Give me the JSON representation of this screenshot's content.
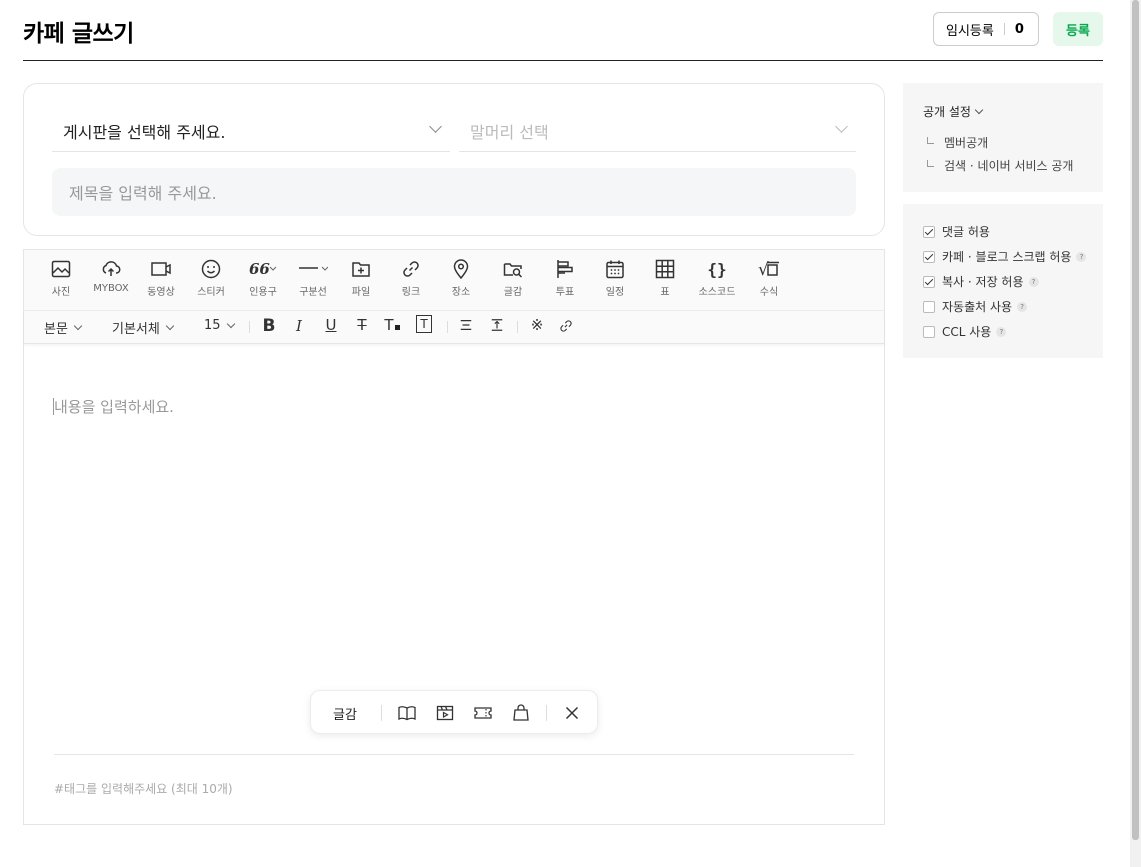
{
  "header": {
    "title": "카페 글쓰기",
    "temp_save_label": "임시등록",
    "temp_save_count": "0",
    "submit_label": "등록"
  },
  "form": {
    "board_select": "게시판을 선택해 주세요.",
    "prefix_select": "말머리 선택",
    "title_placeholder": "제목을 입력해 주세요."
  },
  "toolbar": {
    "items": [
      {
        "label": "사진",
        "icon": "photo-icon"
      },
      {
        "label": "MYBOX",
        "icon": "cloud-upload-icon"
      },
      {
        "label": "동영상",
        "icon": "video-icon"
      },
      {
        "label": "스티커",
        "icon": "sticker-icon"
      },
      {
        "label": "인용구",
        "icon": "quote-icon"
      },
      {
        "label": "구분선",
        "icon": "divider-icon"
      },
      {
        "label": "파일",
        "icon": "file-icon"
      },
      {
        "label": "링크",
        "icon": "link-icon"
      },
      {
        "label": "장소",
        "icon": "place-icon"
      },
      {
        "label": "글감",
        "icon": "material-icon"
      },
      {
        "label": "투표",
        "icon": "vote-icon"
      },
      {
        "label": "일정",
        "icon": "calendar-icon"
      },
      {
        "label": "표",
        "icon": "table-icon"
      },
      {
        "label": "소스코드",
        "icon": "source-code-icon"
      },
      {
        "label": "수식",
        "icon": "formula-icon"
      }
    ],
    "quote_glyph": "66",
    "code_glyph": "{}",
    "formula_glyph": "√",
    "formula_box": "□"
  },
  "format_bar": {
    "paragraph": "본문",
    "font": "기본서체",
    "size": "15",
    "bold": "B",
    "italic": "I",
    "underline": "U",
    "strike": "T",
    "font_color": "T",
    "bg_color": "T",
    "special_char": "※"
  },
  "editor": {
    "content_placeholder": "내용을 입력하세요.",
    "tag_placeholder": "#태그를 입력해주세요 (최대 10개)"
  },
  "floating_bar": {
    "label": "글감"
  },
  "publish": {
    "header": "공개 설정",
    "items": [
      "멤버공개",
      "검색 · 네이버 서비스 공개"
    ]
  },
  "options": {
    "items": [
      {
        "label": "댓글 허용",
        "checked": true,
        "help": false
      },
      {
        "label": "카페 · 블로그 스크랩 허용",
        "checked": true,
        "help": true
      },
      {
        "label": "복사 · 저장 허용",
        "checked": true,
        "help": true
      },
      {
        "label": "자동출처 사용",
        "checked": false,
        "help": true
      },
      {
        "label": "CCL 사용",
        "checked": false,
        "help": true
      }
    ],
    "help_glyph": "?"
  },
  "colors": {
    "accent_green": "#03a94d",
    "accent_green_bg": "#e6f7ec"
  }
}
